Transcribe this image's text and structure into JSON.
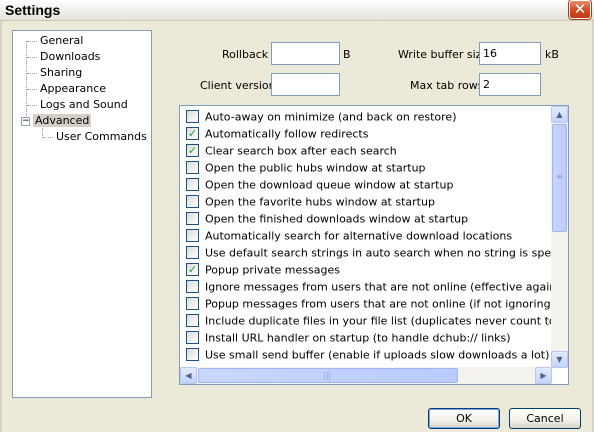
{
  "window": {
    "title": "Settings"
  },
  "tree": {
    "items": [
      {
        "label": "General"
      },
      {
        "label": "Downloads"
      },
      {
        "label": "Sharing"
      },
      {
        "label": "Appearance"
      },
      {
        "label": "Logs and Sound"
      },
      {
        "label": "Advanced",
        "selected": true
      },
      {
        "label": "User Commands"
      }
    ],
    "expander": "−"
  },
  "fields": {
    "rollback": {
      "label": "Rollback",
      "value": "",
      "unit": "B"
    },
    "write_buffer": {
      "label": "Write buffer size",
      "value": "16",
      "unit": "kB"
    },
    "client_version": {
      "label": "Client version",
      "value": ""
    },
    "max_tab_rows": {
      "label": "Max tab rows",
      "value": "2"
    }
  },
  "options": [
    {
      "label": "Auto-away on minimize (and back on restore)",
      "checked": false
    },
    {
      "label": "Automatically follow redirects",
      "checked": true
    },
    {
      "label": "Clear search box after each search",
      "checked": true
    },
    {
      "label": "Open the public hubs window at startup",
      "checked": false
    },
    {
      "label": "Open the download queue window at startup",
      "checked": false
    },
    {
      "label": "Open the favorite hubs window at startup",
      "checked": false
    },
    {
      "label": "Open the finished downloads window at startup",
      "checked": false
    },
    {
      "label": "Automatically search for alternative download locations",
      "checked": false
    },
    {
      "label": "Use default search strings in auto search when no string is specified",
      "checked": false
    },
    {
      "label": "Popup private messages",
      "checked": true
    },
    {
      "label": "Ignore messages from users that are not online (effective against bots)",
      "checked": false
    },
    {
      "label": "Popup messages from users that are not online (if not ignoring, messages",
      "checked": false
    },
    {
      "label": "Include duplicate files in your file list (duplicates never count towards your",
      "checked": false
    },
    {
      "label": "Install URL handler on startup (to handle dchub:// links)",
      "checked": false
    },
    {
      "label": "Use small send buffer (enable if uploads slow downloads a lot)",
      "checked": false
    }
  ],
  "buttons": {
    "ok": "OK",
    "cancel": "Cancel"
  },
  "icons": {
    "check": "✓",
    "close": "✕",
    "up": "▲",
    "down": "▼",
    "left": "◀",
    "right": "▶",
    "grip_v": "≡",
    "grip_h": "|||"
  },
  "colors": {
    "checkmark": "#21a121",
    "close_button": "#d44c27",
    "border": "#7f9db9"
  }
}
